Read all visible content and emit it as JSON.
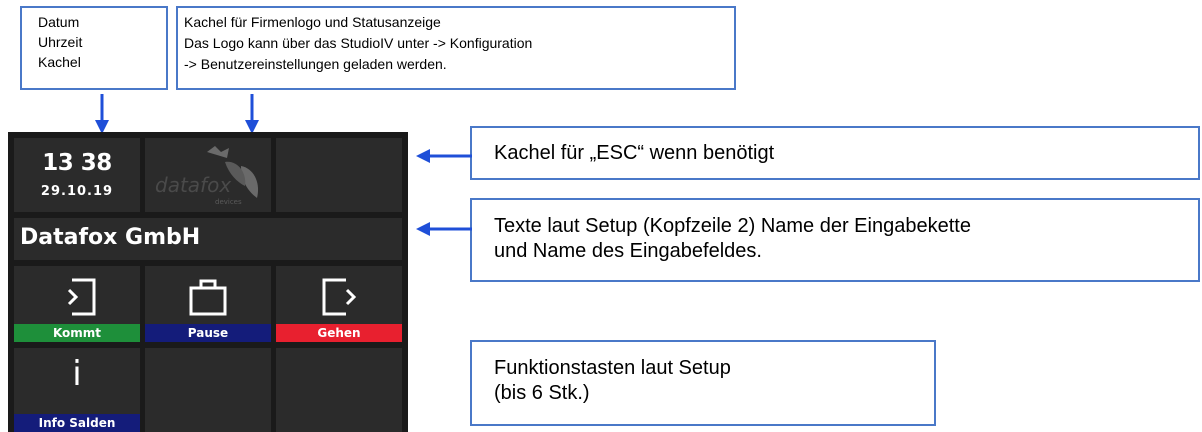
{
  "callouts": {
    "datetime": {
      "lines": [
        "Datum",
        "Uhrzeit",
        "Kachel"
      ]
    },
    "logo": {
      "lines": [
        "Kachel für Firmenlogo und Statusanzeige",
        "Das Logo kann über das StudioIV unter -> Konfiguration",
        "-> Benutzereinstellungen geladen werden."
      ]
    },
    "esc": {
      "lines": [
        "Kachel für „ESC“ wenn benötigt"
      ]
    },
    "texts": {
      "lines": [
        "Texte laut Setup (Kopfzeile 2) Name der Eingabekette",
        "und Name des Eingabefeldes."
      ]
    },
    "functions": {
      "lines": [
        "Funktionstasten laut Setup",
        "(bis 6 Stk.)"
      ]
    }
  },
  "device": {
    "time": "13 38",
    "date": "29.10.19",
    "logo": {
      "brand": "datafox",
      "sub": "devices"
    },
    "header_text": "Datafox GmbH",
    "buttons": [
      {
        "label": "Kommt",
        "icon": "login-icon",
        "color": "#1e8f3a"
      },
      {
        "label": "Pause",
        "icon": "briefcase-icon",
        "color": "#141c7a"
      },
      {
        "label": "Gehen",
        "icon": "logout-icon",
        "color": "#e8202f"
      },
      {
        "label": "Info Salden",
        "icon": "info-icon",
        "color": "#141c7a"
      }
    ]
  },
  "colors": {
    "callout_border": "#4a78c8",
    "arrow": "#1f4fd8",
    "device_bg": "#1a1a1a",
    "tile_bg": "#2b2b2b"
  }
}
